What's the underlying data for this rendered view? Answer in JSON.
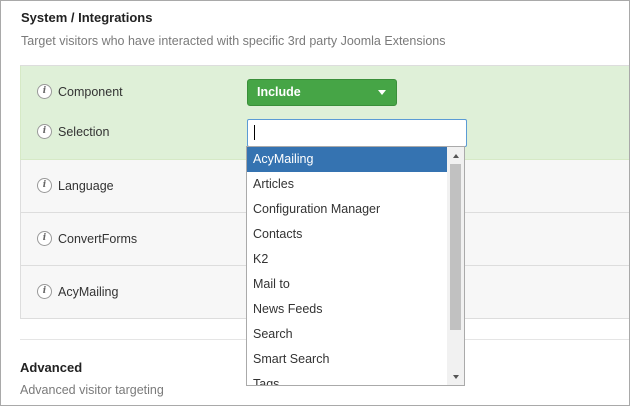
{
  "section": {
    "title": "System / Integrations",
    "description": "Target visitors who have interacted with specific 3rd party Joomla Extensions"
  },
  "rows": [
    {
      "label": "Component",
      "icon": "info-icon"
    },
    {
      "label": "Selection",
      "icon": "info-icon"
    },
    {
      "label": "Language",
      "icon": "info-icon"
    },
    {
      "label": "ConvertForms",
      "icon": "info-icon"
    },
    {
      "label": "AcyMailing",
      "icon": "info-icon"
    }
  ],
  "include_select": {
    "value": "Include",
    "color": "#46a546"
  },
  "search": {
    "value": "",
    "placeholder": ""
  },
  "dropdown": {
    "highlighted_color": "#3573b1",
    "options": [
      "AcyMailing",
      "Articles",
      "Configuration Manager",
      "Contacts",
      "K2",
      "Mail to",
      "News Feeds",
      "Search",
      "Smart Search",
      "Tags"
    ],
    "highlighted_index": 0
  },
  "advanced": {
    "title": "Advanced",
    "description": "Advanced visitor targeting"
  }
}
